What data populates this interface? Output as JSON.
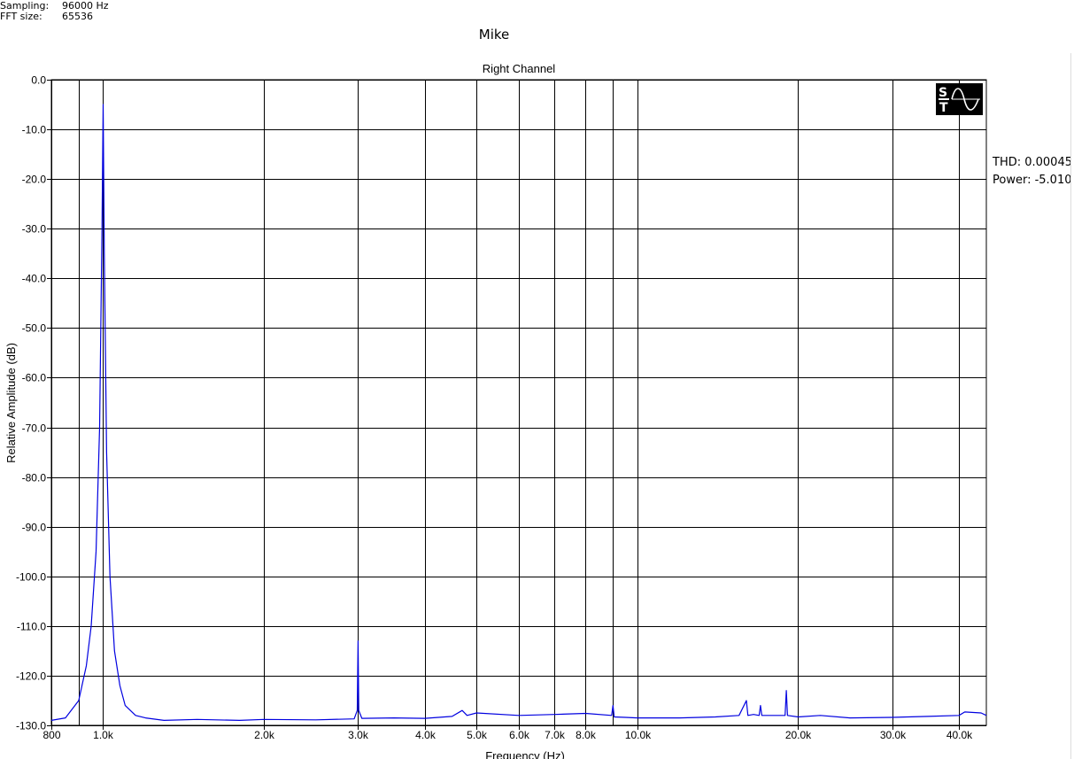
{
  "meta": {
    "sampling_label": "Sampling:",
    "sampling_value": "96000 Hz",
    "fft_label": "FFT size:",
    "fft_value": "65536"
  },
  "title": "Mike",
  "stats": {
    "thd": "THD: 0.00045",
    "power": "Power: -5.010"
  },
  "colors": {
    "series": "#0000e0",
    "grid": "#000000",
    "logo_bg": "#000000",
    "logo_fg": "#ffffff"
  },
  "chart_data": {
    "type": "line",
    "title": "Right Channel",
    "xlabel": "Frequency (Hz)",
    "ylabel": "Relative Amplitude (dB)",
    "xscale": "log",
    "xlim": [
      800,
      45000
    ],
    "ylim": [
      -130,
      0
    ],
    "grid": true,
    "xticks": [
      {
        "value": 800,
        "label": "800"
      },
      {
        "value": 1000,
        "label": "1.0k"
      },
      {
        "value": 2000,
        "label": "2.0k"
      },
      {
        "value": 3000,
        "label": "3.0k"
      },
      {
        "value": 4000,
        "label": "4.0k"
      },
      {
        "value": 5000,
        "label": "5.0k"
      },
      {
        "value": 6000,
        "label": "6.0k"
      },
      {
        "value": 7000,
        "label": "7.0k"
      },
      {
        "value": 8000,
        "label": "8.0k"
      },
      {
        "value": 10000,
        "label": "10.0k"
      },
      {
        "value": 20000,
        "label": "20.0k"
      },
      {
        "value": 30000,
        "label": "30.0k"
      },
      {
        "value": 40000,
        "label": "40.0k"
      }
    ],
    "x_minor_gridlines": [
      900,
      9000
    ],
    "yticks": [
      {
        "value": 0,
        "label": "0.0"
      },
      {
        "value": -10,
        "label": "-10.0"
      },
      {
        "value": -20,
        "label": "-20.0"
      },
      {
        "value": -30,
        "label": "-30.0"
      },
      {
        "value": -40,
        "label": "-40.0"
      },
      {
        "value": -50,
        "label": "-50.0"
      },
      {
        "value": -60,
        "label": "-60.0"
      },
      {
        "value": -70,
        "label": "-70.0"
      },
      {
        "value": -80,
        "label": "-80.0"
      },
      {
        "value": -90,
        "label": "-90.0"
      },
      {
        "value": -100,
        "label": "-100.0"
      },
      {
        "value": -110,
        "label": "-110.0"
      },
      {
        "value": -120,
        "label": "-120.0"
      },
      {
        "value": -130,
        "label": "-130.0"
      }
    ],
    "series": [
      {
        "x": [
          800,
          850,
          900,
          930,
          950,
          970,
          985,
          995,
          1000,
          1005,
          1015,
          1030,
          1050,
          1075,
          1100,
          1150,
          1200,
          1300,
          1500,
          1800,
          2000,
          2500,
          2950,
          2990,
          3000,
          3010,
          3050,
          3500,
          4000,
          4500,
          4700,
          4800,
          5000,
          6000,
          7000,
          8000,
          8950,
          9000,
          9050,
          9500,
          10000,
          12000,
          14000,
          15500,
          16000,
          16100,
          16500,
          16900,
          17000,
          17100,
          18000,
          18900,
          19000,
          19100,
          20000,
          22000,
          25000,
          30000,
          35000,
          40000,
          41000,
          44000,
          45000
        ],
        "y": [
          -129,
          -128.5,
          -125,
          -118,
          -110,
          -95,
          -70,
          -30,
          -5,
          -35,
          -75,
          -100,
          -115,
          -122,
          -126,
          -128,
          -128.5,
          -129,
          -128.8,
          -129,
          -128.8,
          -128.9,
          -128.7,
          -127,
          -113,
          -127,
          -128.6,
          -128.5,
          -128.6,
          -128.2,
          -127,
          -128,
          -127.5,
          -128,
          -127.8,
          -127.6,
          -128,
          -126,
          -128.3,
          -128.4,
          -128.5,
          -128.5,
          -128.3,
          -128,
          -125,
          -128,
          -127.8,
          -128,
          -126,
          -128,
          -128,
          -128,
          -123,
          -128,
          -128.3,
          -128,
          -128.5,
          -128.4,
          -128.2,
          -128,
          -127.3,
          -127.5,
          -128
        ]
      }
    ]
  }
}
